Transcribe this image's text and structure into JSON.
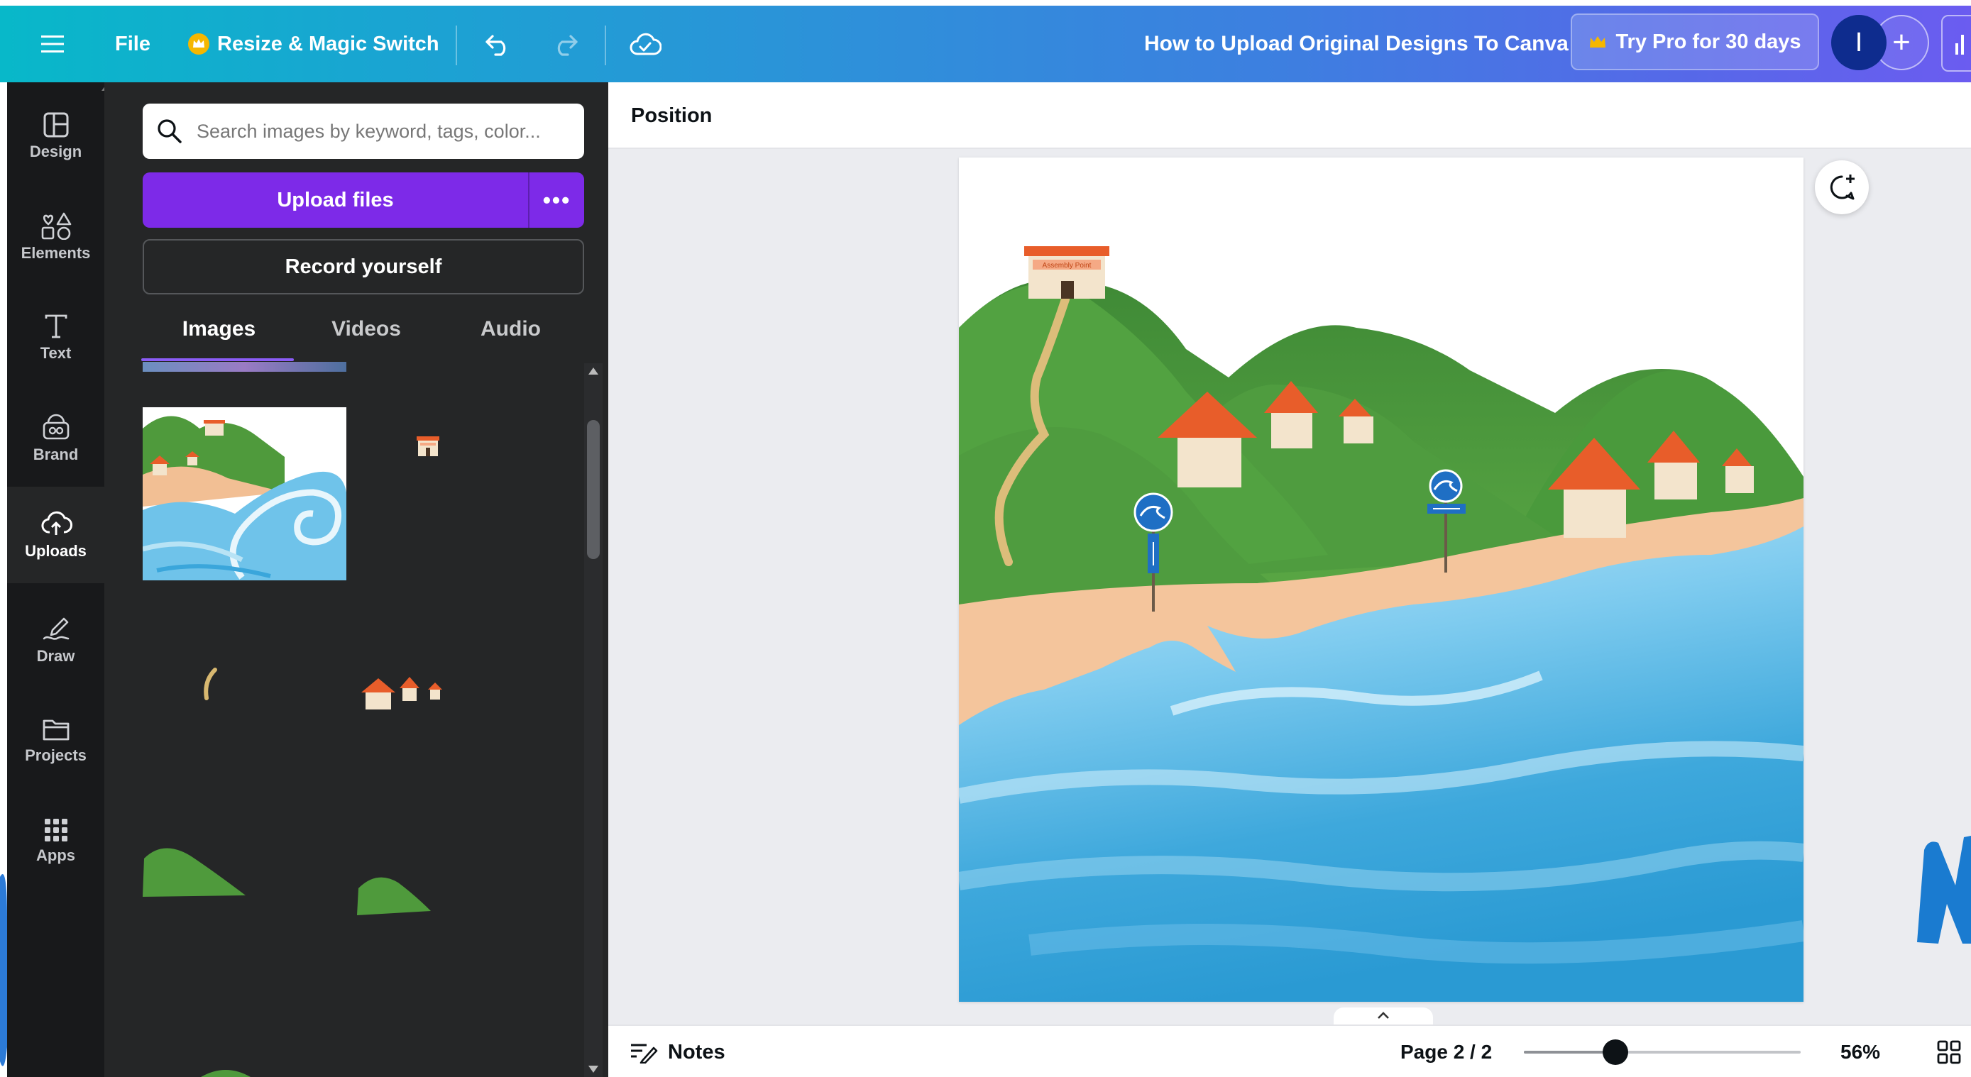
{
  "topbar": {
    "menu_icon": "hamburger-menu-icon",
    "file_label": "File",
    "resize_label": "Resize & Magic Switch",
    "doc_title": "How to Upload Original Designs To Canva",
    "try_pro_label": "Try Pro for 30 days",
    "avatar_initial": "I",
    "add_label": "+"
  },
  "rail": {
    "items": [
      {
        "label": "Design",
        "icon": "design-layout-icon"
      },
      {
        "label": "Elements",
        "icon": "elements-shapes-icon"
      },
      {
        "label": "Text",
        "icon": "text-t-icon"
      },
      {
        "label": "Brand",
        "icon": "brand-icon"
      },
      {
        "label": "Uploads",
        "icon": "upload-cloud-icon"
      },
      {
        "label": "Draw",
        "icon": "draw-pen-icon"
      },
      {
        "label": "Projects",
        "icon": "folder-icon"
      },
      {
        "label": "Apps",
        "icon": "apps-grid-icon"
      }
    ],
    "active": "Uploads"
  },
  "panel": {
    "search_placeholder": "Search images by keyword, tags, color...",
    "upload_label": "Upload files",
    "more_label": "•••",
    "record_label": "Record yourself",
    "tabs": [
      "Images",
      "Videos",
      "Audio"
    ],
    "active_tab": "Images"
  },
  "workspace": {
    "context_label": "Position",
    "notes_label": "Notes",
    "page_indicator": "Page 2 / 2",
    "zoom_label": "56%",
    "zoom_fraction": 0.33,
    "canvas_sign_text": "Assembly Point"
  },
  "colors": {
    "accent_purple": "#7d2ae8",
    "panel_bg": "#252627",
    "rail_bg": "#18191b",
    "topbar_start": "#08b8c9",
    "topbar_end": "#6b5cf0"
  }
}
